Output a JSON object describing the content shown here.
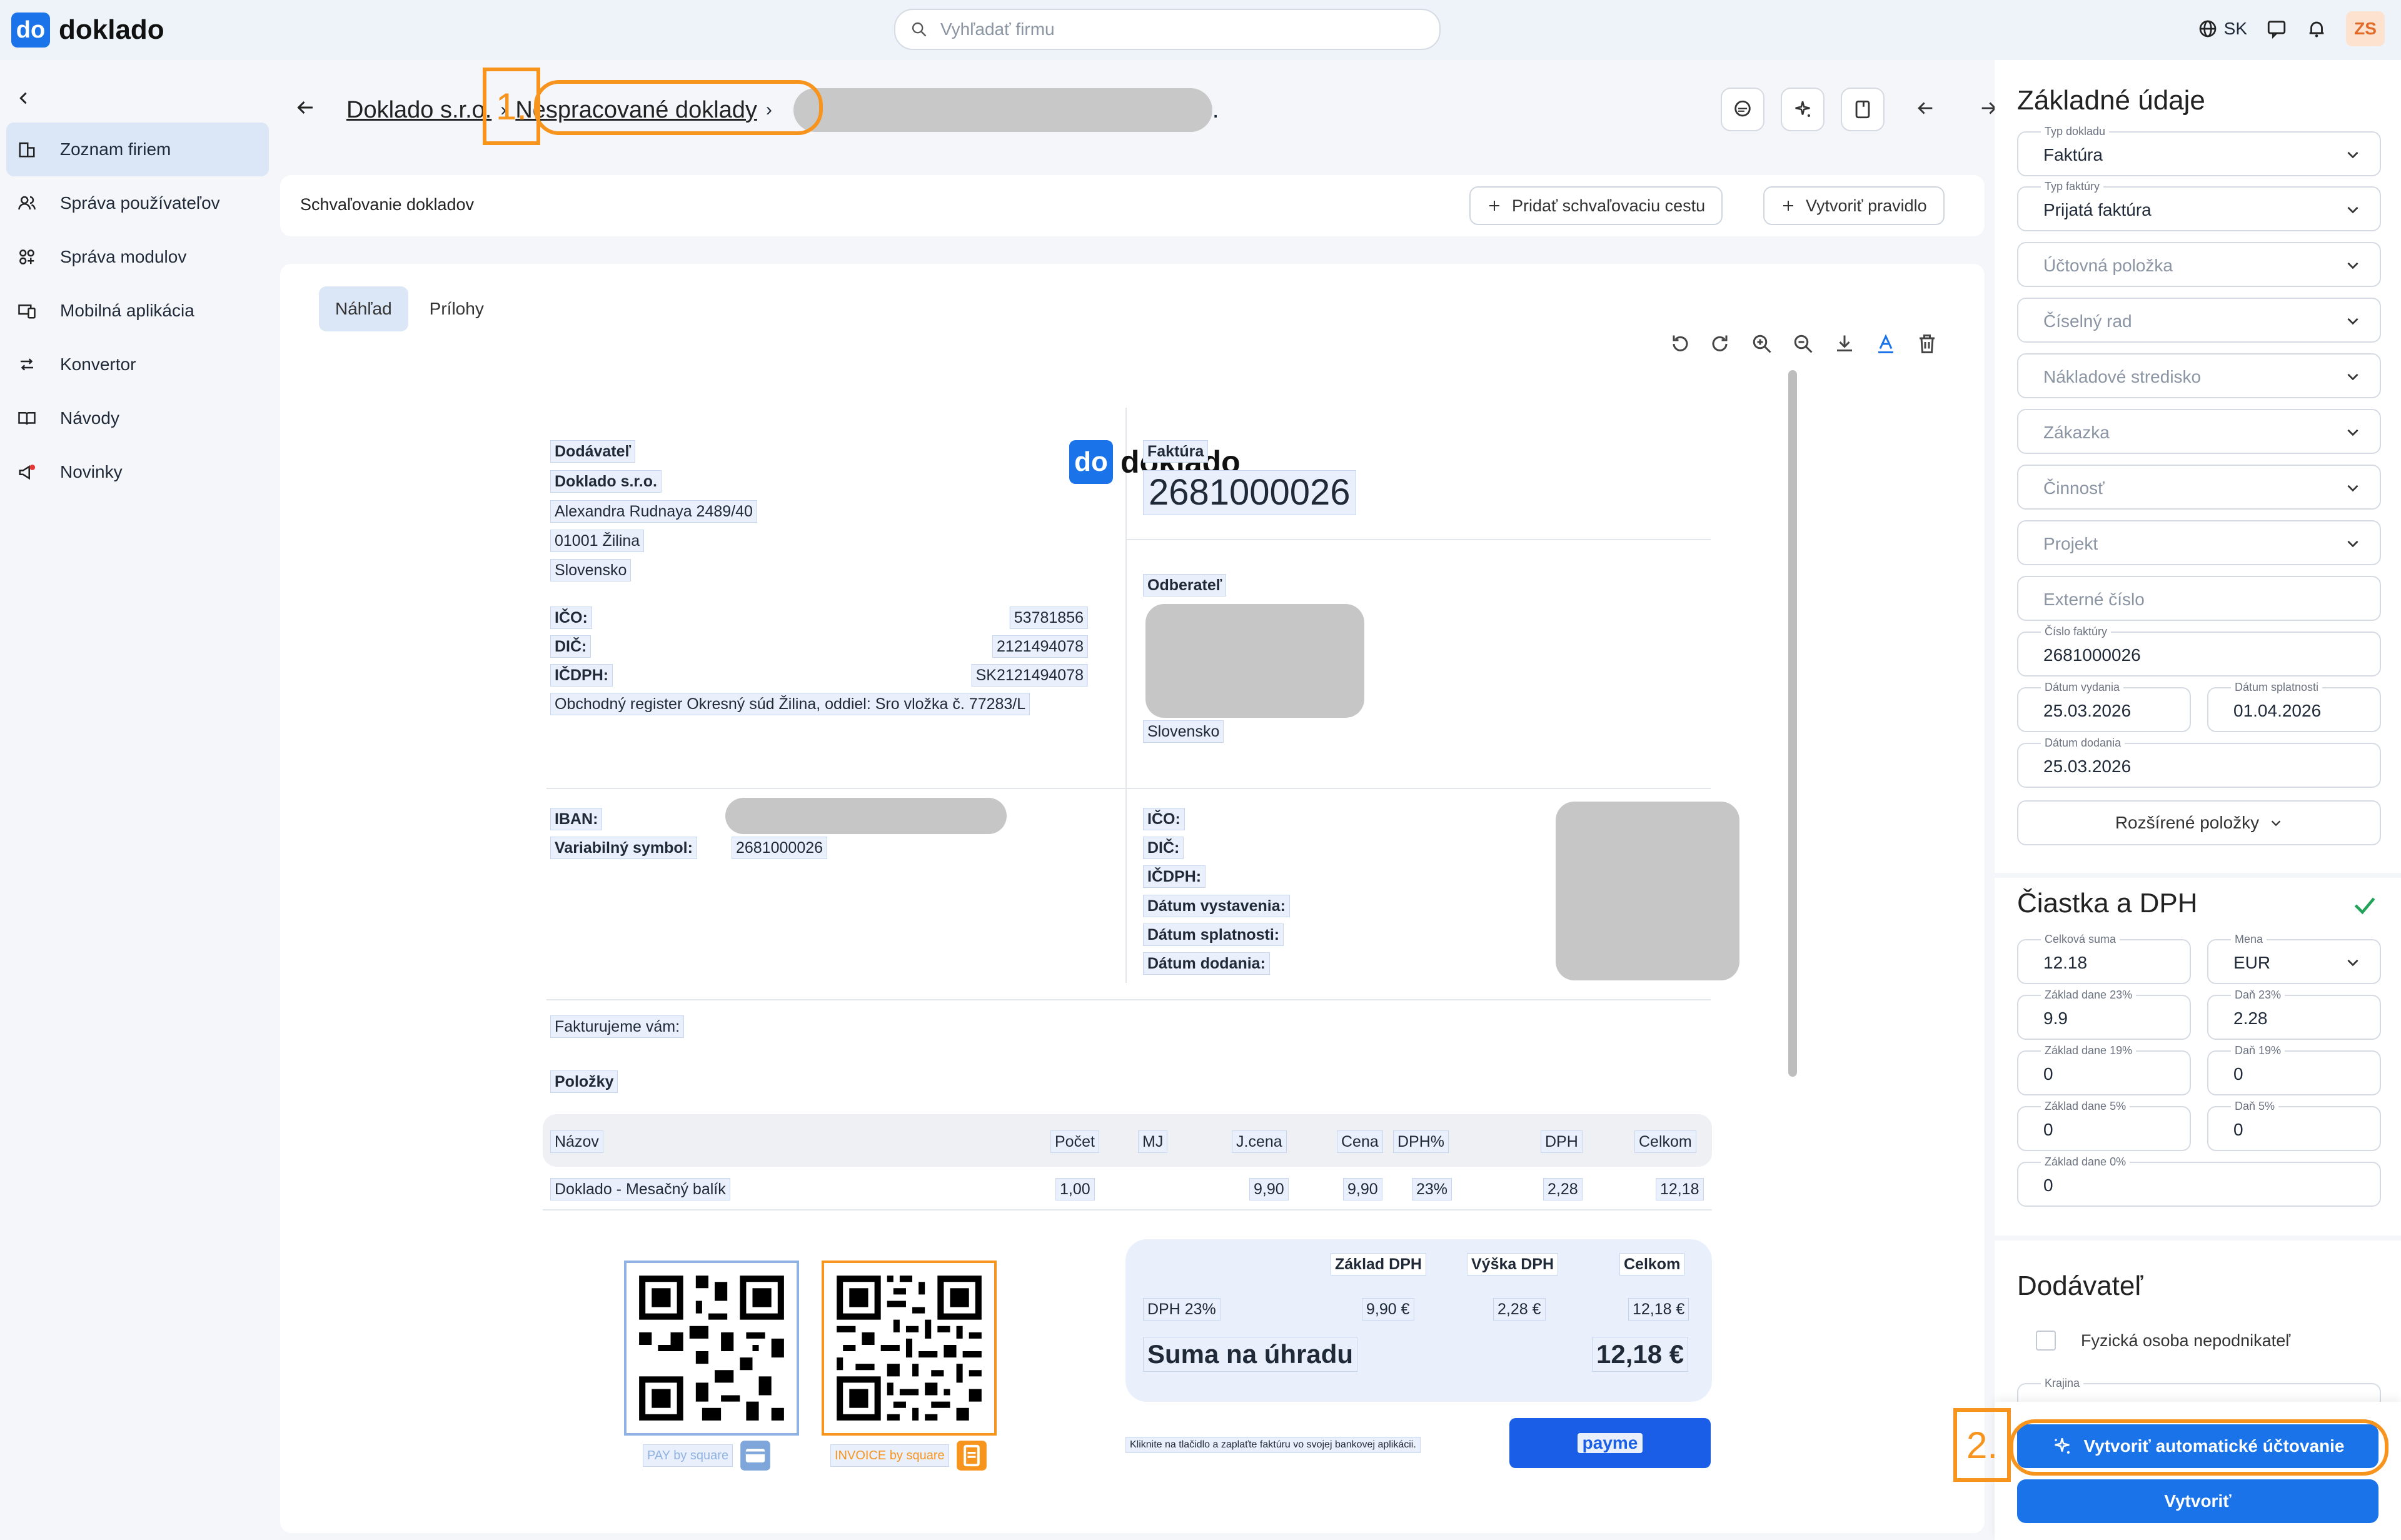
{
  "app": {
    "logo_mark": "do",
    "logo_text": "doklado",
    "search_placeholder": "Vyhľadať firmu",
    "language": "SK",
    "user_initials": "ZS"
  },
  "sidebar": {
    "items": [
      {
        "label": "Zoznam firiem",
        "icon": "building-icon",
        "active": true
      },
      {
        "label": "Správa používateľov",
        "icon": "users-icon"
      },
      {
        "label": "Správa modulov",
        "icon": "modules-icon"
      },
      {
        "label": "Mobilná aplikácia",
        "icon": "mobile-icon"
      },
      {
        "label": "Konvertor",
        "icon": "convert-icon"
      },
      {
        "label": "Návody",
        "icon": "book-icon"
      },
      {
        "label": "Novinky",
        "icon": "megaphone-icon"
      }
    ]
  },
  "breadcrumb": {
    "company": "Doklado s.r.o.",
    "section": "Nespracované doklady",
    "trailing": "."
  },
  "annotations": {
    "marker1": "1.",
    "marker2": "2."
  },
  "approval": {
    "title": "Schvaľovanie dokladov",
    "add_path": "Pridať schvaľovaciu cestu",
    "create_rule": "Vytvoriť pravidlo"
  },
  "tabs": [
    "Náhľad",
    "Prílohy"
  ],
  "invoice": {
    "supplier_heading": "Dodávateľ",
    "supplier_name": "Doklado s.r.o.",
    "supplier_street": "Alexandra Rudnaya 2489/40",
    "supplier_city": "01001 Žilina",
    "supplier_country": "Slovensko",
    "ico_label": "IČO:",
    "ico": "53781856",
    "dic_label": "DIČ:",
    "dic": "2121494078",
    "icdph_label": "IČDPH:",
    "icdph": "SK2121494078",
    "register": "Obchodný register Okresný súd Žilina, oddiel: Sro vložka č. 77283/L",
    "logo_mark": "do",
    "logo_text": "doklado",
    "doc_type": "Faktúra",
    "doc_number": "2681000026",
    "customer_heading": "Odberateľ",
    "customer_country": "Slovensko",
    "iban_label": "IBAN:",
    "vs_label": "Variabilný symbol:",
    "vs": "2681000026",
    "c_ico": "IČO:",
    "c_dic": "DIČ:",
    "c_icdph": "IČDPH:",
    "date_issue": "Dátum vystavenia:",
    "date_due": "Dátum splatnosti:",
    "date_delivery": "Dátum dodania:",
    "we_invoice": "Fakturujeme vám:",
    "items_heading": "Položky",
    "columns": [
      "Názov",
      "Počet",
      "MJ",
      "J.cena",
      "Cena",
      "DPH%",
      "DPH",
      "Celkom"
    ],
    "rows": [
      {
        "name": "Doklado - Mesačný balík",
        "qty": "1,00",
        "unit": "",
        "unit_price": "9,90",
        "price": "9,90",
        "vat_pct": "23%",
        "vat": "2,28",
        "total": "12,18"
      }
    ],
    "summary_cols": [
      "Základ DPH",
      "Výška DPH",
      "Celkom"
    ],
    "summary_row": {
      "label": "DPH 23%",
      "base": "9,90 €",
      "vat": "2,28 €",
      "total": "12,18 €"
    },
    "to_pay_label": "Suma na úhradu",
    "to_pay": "12,18 €",
    "pay_qr_label": "PAY by square",
    "invoice_qr_label": "INVOICE by square",
    "payme_note": "Kliknite na tlačidlo a zaplaťte faktúru vo svojej bankovej aplikácii.",
    "payme": "payme"
  },
  "form": {
    "basic_title": "Základné údaje",
    "doc_type_label": "Typ dokladu",
    "doc_type": "Faktúra",
    "inv_type_label": "Typ faktúry",
    "inv_type": "Prijatá faktúra",
    "accounting_item": "Účtovná položka",
    "number_series": "Číselný rad",
    "cost_center": "Nákladové stredisko",
    "order": "Zákazka",
    "activity": "Činnosť",
    "project": "Projekt",
    "external_no": "Externé číslo",
    "inv_no_label": "Číslo faktúry",
    "inv_no": "2681000026",
    "issue_label": "Dátum vydania",
    "issue": "25.03.2026",
    "due_label": "Dátum splatnosti",
    "due": "01.04.2026",
    "delivery_label": "Dátum dodania",
    "delivery": "25.03.2026",
    "extended": "Rozšírené položky",
    "amount_title": "Čiastka a DPH",
    "total_label": "Celková suma",
    "total": "12.18",
    "currency_label": "Mena",
    "currency": "EUR",
    "base23_label": "Základ dane 23%",
    "base23": "9.9",
    "vat23_label": "Daň 23%",
    "vat23": "2.28",
    "base19_label": "Základ dane 19%",
    "base19": "0",
    "vat19_label": "Daň 19%",
    "vat19": "0",
    "base5_label": "Základ dane 5%",
    "base5": "0",
    "vat5_label": "Daň 5%",
    "vat5": "0",
    "base0_label": "Základ dane 0%",
    "base0": "0",
    "supplier_title": "Dodávateľ",
    "natural_person": "Fyzická osoba nepodnikateľ",
    "country_label": "Krajina",
    "auto_btn": "Vytvoriť automatické účtovanie",
    "create_btn": "Vytvoriť"
  },
  "colors": {
    "accent": "#1a73e8",
    "annotation": "#f7941d",
    "success": "#22a35a"
  }
}
